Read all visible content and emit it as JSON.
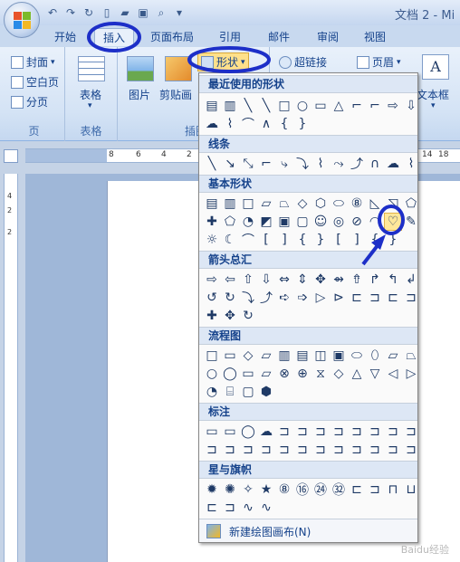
{
  "window": {
    "doc_title": "文档 2 - Mi",
    "office_button_icon": "office-logo",
    "qat_icons": [
      "undo-icon",
      "redo-icon",
      "new-doc-icon",
      "open-folder-icon",
      "save-icon",
      "print-preview-icon",
      "customize-dropdown-icon"
    ]
  },
  "tabs": [
    {
      "label": "开始"
    },
    {
      "label": "插入"
    },
    {
      "label": "页面布局"
    },
    {
      "label": "引用"
    },
    {
      "label": "邮件"
    },
    {
      "label": "审阅"
    },
    {
      "label": "视图"
    }
  ],
  "ribbon": {
    "pages": {
      "cover": "封面",
      "blank": "空白页",
      "break": "分页",
      "label": "页"
    },
    "table": {
      "button": "表格",
      "label": "表格"
    },
    "illustrations": {
      "picture": "图片",
      "clipart": "剪贴画",
      "shapes": "形状",
      "label": "插图"
    },
    "links": {
      "hyperlink": "超链接"
    },
    "header": {
      "button": "页眉"
    },
    "text": {
      "textbox": "文本框"
    }
  },
  "ruler": {
    "numbers": [
      "8",
      "6",
      "4",
      "2",
      "2",
      "4",
      "6",
      "8",
      "10",
      "12",
      "14",
      "16",
      "18"
    ],
    "vnumbers": [
      "4",
      "2",
      "2"
    ]
  },
  "dropdown": {
    "sections": [
      "最近使用的形状",
      "线条",
      "基本形状",
      "箭头总汇",
      "流程图",
      "标注",
      "星与旗帜"
    ],
    "recent_row1": [
      "▤",
      "▥",
      "╲",
      "╲",
      "□",
      "○",
      "▭",
      "△",
      "⌐",
      "⌐",
      "⇨",
      "⇩"
    ],
    "recent_row2": [
      "☁",
      "⌇",
      "⌒",
      "∧",
      "{",
      "}"
    ],
    "lines_row": [
      "╲",
      "↘",
      "⤡",
      "⌐",
      "⤷",
      "⤵",
      "⌇",
      "⤳",
      "⤴",
      "∩",
      "☁",
      "⌇"
    ],
    "basic_row1": [
      "▤",
      "▥",
      "□",
      "▱",
      "⏢",
      "◇",
      "⬡",
      "⬭",
      "⑧",
      "◺",
      "◹",
      "⬠"
    ],
    "basic_row2": [
      "✚",
      "⬠",
      "◔",
      "◩",
      "▣",
      "▢",
      "☺",
      "◎",
      "⊘",
      "◠",
      "♡",
      "✎"
    ],
    "basic_row3": [
      "☼",
      "☾",
      "⌒",
      "[",
      "]",
      "{",
      "}",
      "[",
      "]",
      "{",
      "}",
      ""
    ],
    "arrows_row1": [
      "⇨",
      "⇦",
      "⇧",
      "⇩",
      "⇔",
      "⇕",
      "✥",
      "⇴",
      "⇮",
      "↱",
      "↰",
      "↲"
    ],
    "arrows_row2": [
      "↺",
      "↻",
      "⤵",
      "⤴",
      "➪",
      "➩",
      "▷",
      "⊳",
      "⊏",
      "⊐",
      "⊏",
      "⊐"
    ],
    "arrows_row3": [
      "✚",
      "✥",
      "↻"
    ],
    "flow_row1": [
      "□",
      "▭",
      "◇",
      "▱",
      "▥",
      "▤",
      "◫",
      "▣",
      "⬭",
      "⬯",
      "▱",
      "⏢"
    ],
    "flow_row2": [
      "○",
      "◯",
      "▭",
      "▱",
      "⊗",
      "⊕",
      "⧖",
      "◇",
      "△",
      "▽",
      "◁",
      "▷"
    ],
    "flow_row3": [
      "◔",
      "⌸",
      "▢",
      "⬢"
    ],
    "callout_row1": [
      "▭",
      "▭",
      "◯",
      "☁",
      "⊐",
      "⊐",
      "⊐",
      "⊐",
      "⊐",
      "⊐",
      "⊐",
      "⊐"
    ],
    "callout_row2": [
      "⊐",
      "⊐",
      "⊐",
      "⊐",
      "⊐",
      "⊐",
      "⊐",
      "⊐",
      "⊐",
      "⊐",
      "⊐",
      "⊐"
    ],
    "stars_row1": [
      "✹",
      "✺",
      "✧",
      "★",
      "⑧",
      "⑯",
      "㉔",
      "㉜",
      "⊏",
      "⊐",
      "⊓",
      "⊔"
    ],
    "stars_row2": [
      "⊏",
      "⊐",
      "∿",
      "∿"
    ],
    "new_canvas_label": "新建绘图画布(N)",
    "selected_shape": "heart-shape"
  },
  "watermark": "Baidu经验",
  "annotation_color": "#1d2fc8"
}
